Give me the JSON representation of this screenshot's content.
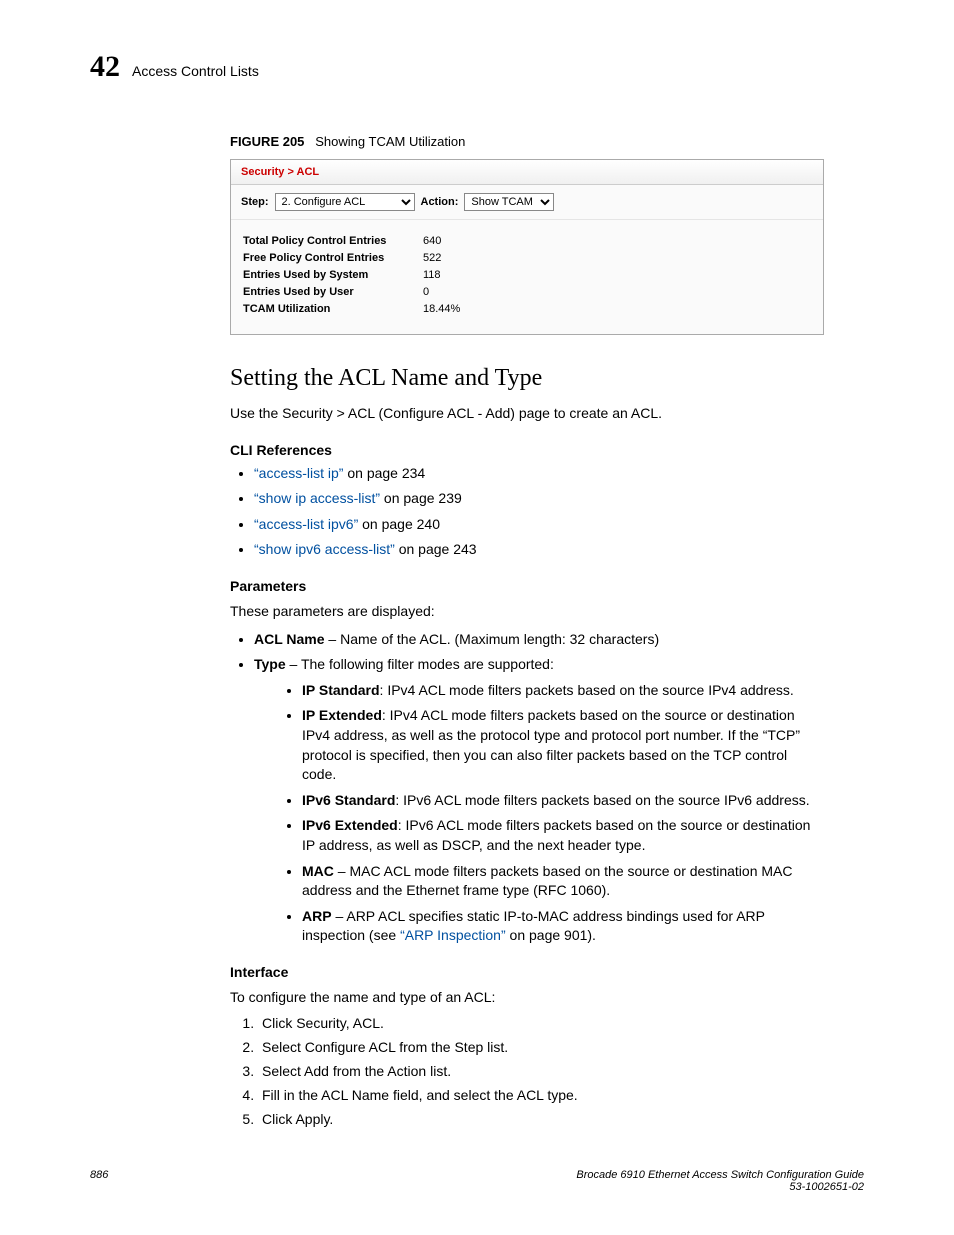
{
  "header": {
    "chapter_num": "42",
    "chapter_title": "Access Control Lists"
  },
  "figure": {
    "label": "FIGURE 205",
    "caption": "Showing TCAM Utilization",
    "breadcrumb": "Security > ACL",
    "step_label": "Step:",
    "step_value": "2. Configure ACL",
    "action_label": "Action:",
    "action_value": "Show TCAM",
    "rows": [
      {
        "label": "Total Policy Control Entries",
        "value": "640"
      },
      {
        "label": "Free Policy Control Entries",
        "value": "522"
      },
      {
        "label": "Entries Used by System",
        "value": "118"
      },
      {
        "label": "Entries Used by User",
        "value": "0"
      },
      {
        "label": "TCAM Utilization",
        "value": "18.44%"
      }
    ]
  },
  "section_title": "Setting the ACL Name and Type",
  "intro": "Use the Security > ACL (Configure ACL - Add) page to create an ACL.",
  "cli_heading": "CLI References",
  "cli_refs": [
    {
      "link": "“access-list ip”",
      "suffix": " on page 234"
    },
    {
      "link": "“show ip access-list”",
      "suffix": " on page 239"
    },
    {
      "link": "“access-list ipv6”",
      "suffix": " on page 240"
    },
    {
      "link": "“show ipv6 access-list”",
      "suffix": " on page 243"
    }
  ],
  "params_heading": "Parameters",
  "params_intro": "These parameters are displayed:",
  "param_acl_name_label": "ACL Name",
  "param_acl_name_desc": " – Name of the ACL. (Maximum length: 32 characters)",
  "param_type_label": "Type",
  "param_type_desc": " – The following filter modes are supported:",
  "types": {
    "ip_std_label": "IP Standard",
    "ip_std_desc": ": IPv4 ACL mode filters packets based on the source IPv4 address.",
    "ip_ext_label": "IP Extended",
    "ip_ext_desc": ": IPv4 ACL mode filters packets based on the source or destination IPv4 address, as well as the protocol type and protocol port number. If the “TCP” protocol is specified, then you can also filter packets based on the TCP control code.",
    "ipv6_std_label": "IPv6 Standard",
    "ipv6_std_desc": ": IPv6 ACL mode filters packets based on the source IPv6 address.",
    "ipv6_ext_label": "IPv6 Extended",
    "ipv6_ext_desc": ": IPv6 ACL mode filters packets based on the source or destination IP address, as well as DSCP, and the next header type.",
    "mac_label": "MAC",
    "mac_desc": " – MAC ACL mode filters packets based on the source or destination MAC address and the Ethernet frame type (RFC 1060).",
    "arp_label": "ARP",
    "arp_desc_pre": " – ARP ACL specifies static IP-to-MAC address bindings used for ARP inspection (see ",
    "arp_link": "“ARP Inspection”",
    "arp_desc_post": " on page 901)."
  },
  "interface_heading": "Interface",
  "interface_intro": "To configure the name and type of an ACL:",
  "steps": [
    "Click Security, ACL.",
    "Select Configure ACL from the Step list.",
    "Select Add from the Action list.",
    "Fill in the ACL Name field, and select the ACL type.",
    "Click Apply."
  ],
  "footer": {
    "page": "886",
    "title": "Brocade 6910 Ethernet Access Switch Configuration Guide",
    "docnum": "53-1002651-02"
  }
}
